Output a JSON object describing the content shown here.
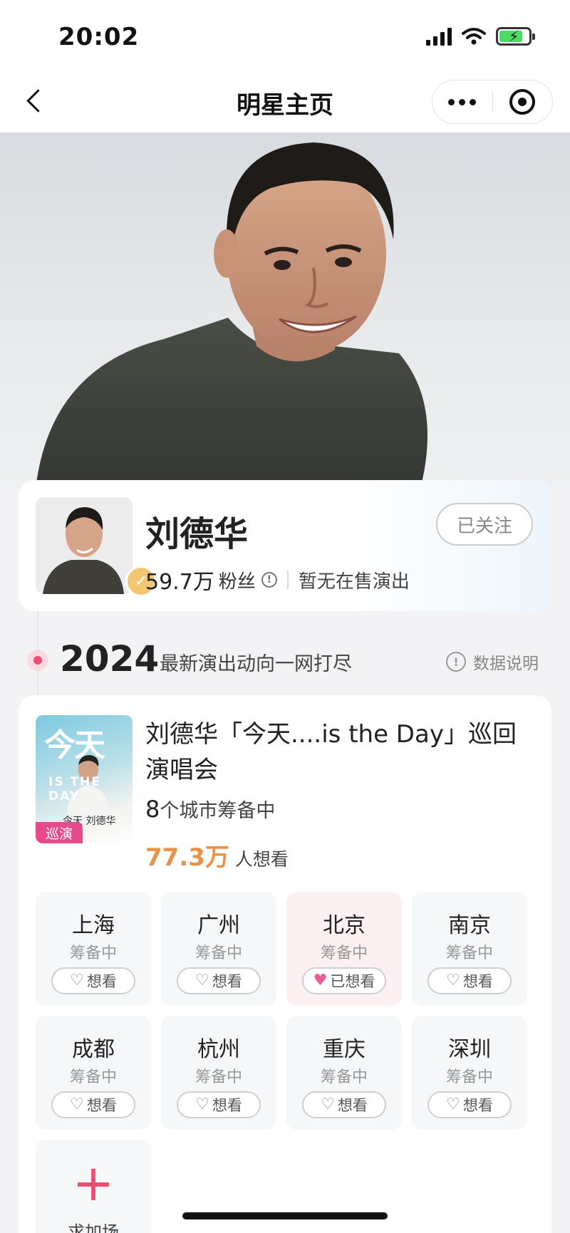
{
  "status_bar": {
    "time": "20:02",
    "icons": [
      "signal-icon",
      "wifi-icon",
      "battery-charging-icon"
    ]
  },
  "nav": {
    "title": "明星主页",
    "icons": [
      "back-icon",
      "more-icon",
      "close-miniprogram-icon"
    ]
  },
  "profile": {
    "name": "刘德华",
    "fans_count": "59.7万",
    "fans_label": "粉丝",
    "on_sale_status": "暂无在售演出",
    "follow_label": "已关注"
  },
  "timeline": {
    "year": "2024",
    "subtitle": "最新演出动向一网打尽",
    "data_note": "数据说明"
  },
  "show": {
    "title": "刘德华「今天....is the Day」巡回演唱会",
    "poster_text": "今天",
    "poster_subtext": "IS THE DAY",
    "poster_caption": "今天 刘德华",
    "tag": "巡演",
    "city_count": "8",
    "city_count_suffix": "个城市筹备中",
    "want_count": "77.3万",
    "want_label": "人想看",
    "cities": [
      {
        "name": "上海",
        "status": "筹备中",
        "button": "想看",
        "wanted": false
      },
      {
        "name": "广州",
        "status": "筹备中",
        "button": "想看",
        "wanted": false
      },
      {
        "name": "北京",
        "status": "筹备中",
        "button": "已想看",
        "wanted": true
      },
      {
        "name": "南京",
        "status": "筹备中",
        "button": "想看",
        "wanted": false
      },
      {
        "name": "成都",
        "status": "筹备中",
        "button": "想看",
        "wanted": false
      },
      {
        "name": "杭州",
        "status": "筹备中",
        "button": "想看",
        "wanted": false
      },
      {
        "name": "重庆",
        "status": "筹备中",
        "button": "想看",
        "wanted": false
      },
      {
        "name": "深圳",
        "status": "筹备中",
        "button": "想看",
        "wanted": false
      }
    ],
    "add_label": "求加场"
  },
  "colors": {
    "accent_pink": "#ef4e73",
    "want_orange": "#e9934a",
    "tour_tag": "#e64a8a",
    "verify_gold": "#f3c772"
  }
}
